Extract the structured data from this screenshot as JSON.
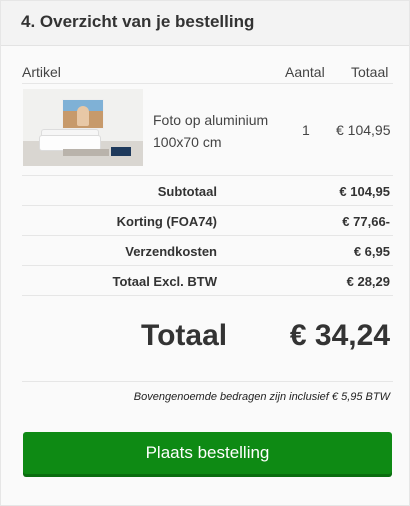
{
  "section": {
    "title": "4. Overzicht van je bestelling"
  },
  "table": {
    "headers": {
      "article": "Artikel",
      "quantity": "Aantal",
      "total": "Totaal"
    },
    "item": {
      "name_line1": "Foto op aluminium",
      "name_line2": "100x70 cm",
      "quantity": "1",
      "price": "€ 104,95",
      "thumbnail_icon": "product-photo-aluminium"
    }
  },
  "summary": [
    {
      "label": "Subtotaal",
      "value": "€ 104,95"
    },
    {
      "label": "Korting (FOA74)",
      "value": "€ 77,66-"
    },
    {
      "label": "Verzendkosten",
      "value": "€ 6,95"
    },
    {
      "label": "Totaal Excl. BTW",
      "value": "€ 28,29"
    }
  ],
  "grand_total": {
    "label": "Totaal",
    "value": "€ 34,24"
  },
  "vat_note": "Bovengenoemde bedragen zijn inclusief € 5,95 BTW",
  "actions": {
    "place_order_label": "Plaats bestelling"
  },
  "colors": {
    "primary_button": "#0e8a14",
    "panel_bg": "#fafafa",
    "header_bg": "#f3f3f3"
  }
}
